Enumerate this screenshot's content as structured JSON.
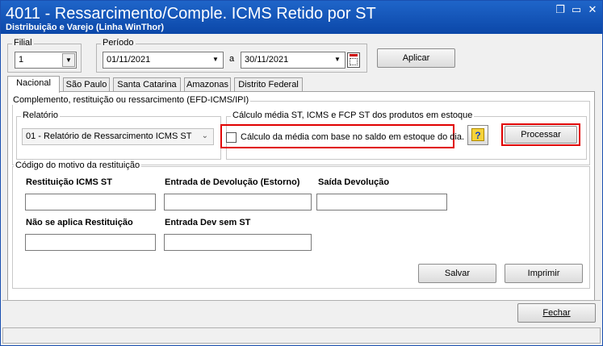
{
  "window": {
    "title": "4011 - Ressarcimento/Comple. ICMS Retido por ST",
    "subtitle": "Distribuição e Varejo (Linha WinThor)",
    "restore_glyph": "❐",
    "minimize_glyph": "▭",
    "close_glyph": "✕"
  },
  "filters": {
    "filial_label": "Filial",
    "filial_value": "1",
    "periodo_label": "Período",
    "date_start": "01/11/2021",
    "date_sep": "a",
    "date_end": "30/11/2021",
    "apply_label": "Aplicar"
  },
  "tabs": [
    "Nacional",
    "São Paulo",
    "Santa Catarina",
    "Amazonas",
    "Distrito Federal"
  ],
  "main": {
    "group_title": "Complemento, restituição ou ressarcimento (EFD-ICMS/IPI)",
    "relatorio_title": "Relatório",
    "relatorio_value": "01 - Relatório de Ressarcimento ICMS ST",
    "calc_title": "Cálculo média ST, ICMS e FCP ST dos produtos em estoque",
    "calc_checkbox_label": "Cálculo da média com base no saldo em estoque do dia.",
    "help_glyph": "?",
    "process_label": "Processar"
  },
  "motivo": {
    "title": "Código do motivo da restituição",
    "field1_label": "Restituição ICMS ST",
    "field2_label": "Entrada de Devolução (Estorno)",
    "field3_label": "Saída Devolução",
    "field4_label": "Não se aplica Restituição",
    "field5_label": "Entrada Dev sem ST",
    "save_label": "Salvar",
    "print_label": "Imprimir"
  },
  "footer": {
    "close_label": "Fechar"
  },
  "colors": {
    "titlebar": "#1556bd",
    "highlight": "#e00000"
  }
}
